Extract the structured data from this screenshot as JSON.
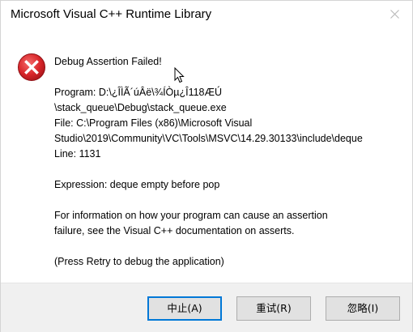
{
  "window": {
    "title": "Microsoft Visual C++ Runtime Library",
    "close_icon": "close-icon"
  },
  "message": {
    "icon": "error-icon",
    "heading": "Debug Assertion Failed!",
    "program_line1": "Program: D:\\¿ÎÌÃ´úÂë\\¾ÍÒµ¿Î118ÆÚ",
    "program_line2": "\\stack_queue\\Debug\\stack_queue.exe",
    "file_line1": "File: C:\\Program Files (x86)\\Microsoft Visual",
    "file_line2": "Studio\\2019\\Community\\VC\\Tools\\MSVC\\14.29.30133\\include\\deque",
    "line_info": "Line: 1131",
    "expression": "Expression: deque empty before pop",
    "info_line1": "For information on how your program can cause an assertion",
    "info_line2": "failure, see the Visual C++ documentation on asserts.",
    "retry_hint": "(Press Retry to debug the application)"
  },
  "buttons": {
    "abort": "中止(A)",
    "retry": "重试(R)",
    "ignore": "忽略(I)"
  }
}
